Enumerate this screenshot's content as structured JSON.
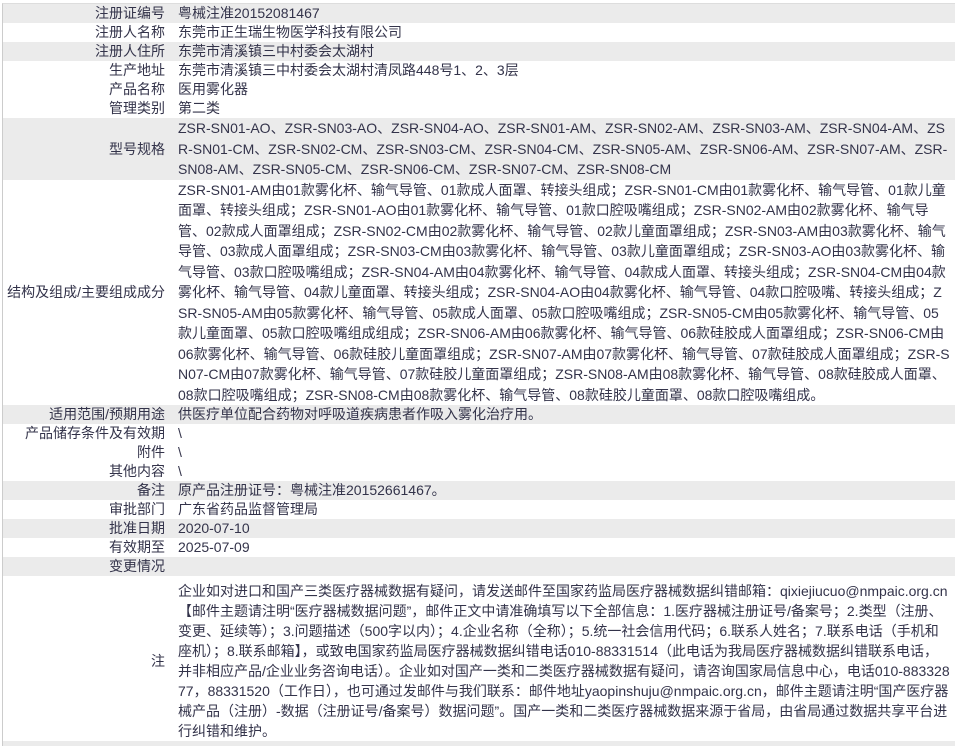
{
  "page": {
    "title": "医疗器械注册信息",
    "text_color": "#33334a",
    "stripe_color": "#ebebeb",
    "border_color": "#cccccc"
  },
  "table": {
    "rows": [
      {
        "label": "注册证编号",
        "value": "粤械注准20152081467",
        "shaded": true
      },
      {
        "label": "注册人名称",
        "value": "东莞市正生瑞生物医学科技有限公司",
        "shaded": false
      },
      {
        "label": "注册人住所",
        "value": "东莞市清溪镇三中村委会太湖村",
        "shaded": true
      },
      {
        "label": "生产地址",
        "value": "东莞市清溪镇三中村委会太湖村清凤路448号1、2、3层",
        "shaded": false
      },
      {
        "label": "产品名称",
        "value": "医用雾化器",
        "shaded": false
      },
      {
        "label": "管理类别",
        "value": "第二类",
        "shaded": false
      },
      {
        "label": "型号规格",
        "value": "ZSR-SN01-AO、ZSR-SN03-AO、ZSR-SN04-AO、ZSR-SN01-AM、ZSR-SN02-AM、ZSR-SN03-AM、ZSR-SN04-AM、ZSR-SN01-CM、ZSR-SN02-CM、ZSR-SN03-CM、ZSR-SN04-CM、ZSR-SN05-AM、ZSR-SN06-AM、ZSR-SN07-AM、ZSR-SN08-AM、ZSR-SN05-CM、ZSR-SN06-CM、ZSR-SN07-CM、ZSR-SN08-CM",
        "shaded": true
      },
      {
        "label": "结构及组成/主要组成成分",
        "value": "ZSR-SN01-AM由01款雾化杯、输气导管、01款成人面罩、转接头组成；ZSR-SN01-CM由01款雾化杯、输气导管、01款儿童面罩、转接头组成；ZSR-SN01-AO由01款雾化杯、输气导管、01款口腔吸嘴组成；ZSR-SN02-AM由02款雾化杯、输气导管、02款成人面罩组成；ZSR-SN02-CM由02款雾化杯、输气导管、02款儿童面罩组成；ZSR-SN03-AM由03款雾化杯、输气导管、03款成人面罩组成；ZSR-SN03-CM由03款雾化杯、输气导管、03款儿童面罩组成；ZSR-SN03-AO由03款雾化杯、输气导管、03款口腔吸嘴组成；ZSR-SN04-AM由04款雾化杯、输气导管、04款成人面罩、转接头组成；ZSR-SN04-CM由04款雾化杯、输气导管、04款儿童面罩、转接头组成；ZSR-SN04-AO由04款雾化杯、输气导管、04款口腔吸嘴、转接头组成；ZSR-SN05-AM由05款雾化杯、输气导管、05款成人面罩、05款口腔吸嘴组成；ZSR-SN05-CM由05款雾化杯、输气导管、05款儿童面罩、05款口腔吸嘴组成组成；ZSR-SN06-AM由06款雾化杯、输气导管、06款硅胶成人面罩组成；ZSR-SN06-CM由06款雾化杯、输气导管、06款硅胶儿童面罩组成；ZSR-SN07-AM由07款雾化杯、输气导管、07款硅胶成人面罩组成；ZSR-SN07-CM由07款雾化杯、输气导管、07款硅胶儿童面罩组成；ZSR-SN08-AM由08款雾化杯、输气导管、08款硅胶成人面罩、08款口腔吸嘴组成；ZSR-SN08-CM由08款雾化杯、输气导管、08款硅胶儿童面罩、08款口腔吸嘴组成。",
        "shaded": false
      },
      {
        "label": "适用范围/预期用途",
        "value": "供医疗单位配合药物对呼吸道疾病患者作吸入雾化治疗用。",
        "shaded": true
      },
      {
        "label": "产品储存条件及有效期",
        "value": "\\",
        "shaded": false
      },
      {
        "label": "附件",
        "value": "\\",
        "shaded": false
      },
      {
        "label": "其他内容",
        "value": "\\",
        "shaded": false
      },
      {
        "label": "备注",
        "value": "原产品注册证号：粤械注准20152661467。",
        "shaded": true
      },
      {
        "label": "审批部门",
        "value": "广东省药品监督管理局",
        "shaded": false
      },
      {
        "label": "批准日期",
        "value": "2020-07-10",
        "shaded": true
      },
      {
        "label": "有效期至",
        "value": "2025-07-09",
        "shaded": false
      },
      {
        "label": "变更情况",
        "value": "",
        "shaded": true
      },
      {
        "label": "注",
        "value": "企业如对进口和国产三类医疗器械数据有疑问，请发送邮件至国家药监局医疗器械数据纠错邮箱：qixiejiucuo@nmpaic.org.cn【邮件主题请注明“医疗器械数据问题”，邮件正文中请准确填写以下全部信息：1.医疗器械注册证号/备案号；2.类型（注册、变更、延续等）；3.问题描述（500字以内）；4.企业名称（全称）；5.统一社会信用代码；6.联系人姓名；7.联系电话（手机和座机）；8.联系邮箱】，或致电国家药监局医疗器械数据纠错电话010-88331514（此电话为我局医疗器械数据纠错联系电话，并非相应产品/企业业务咨询电话）。企业如对国产一类和二类医疗器械数据有疑问，请咨询国家局信息中心，电话010-88332877，88331520（工作日），也可通过发邮件与我们联系：邮件地址yaopinshuju@nmpaic.org.cn，邮件主题请注明“国产医疗器械产品（注册）-数据（注册证号/备案号）数据问题”。国产一类和二类医疗器械数据来源于省局，由省局通过数据共享平台进行纠错和维护。",
        "shaded": false
      }
    ]
  }
}
